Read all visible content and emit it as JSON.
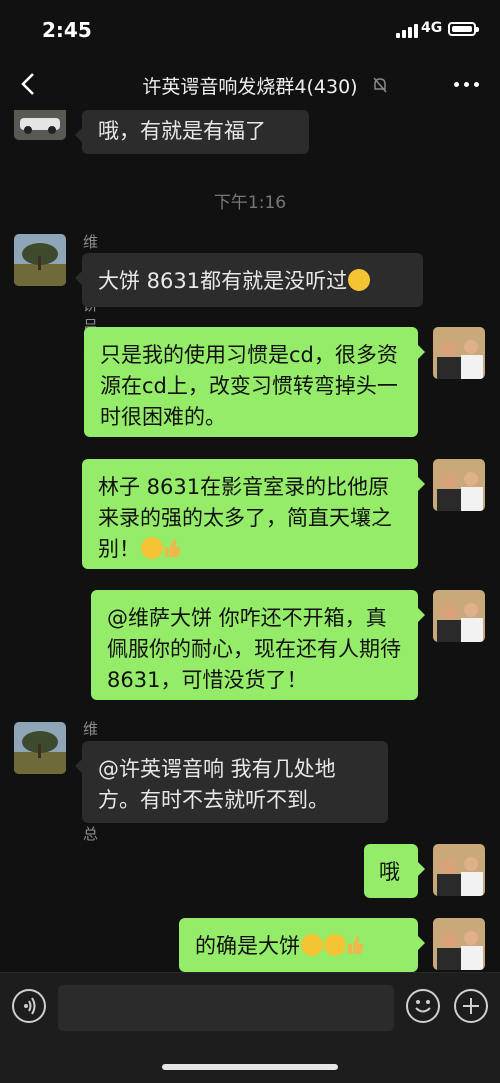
{
  "status_bar": {
    "time": "2:45",
    "network": "4G"
  },
  "header": {
    "title": "许英谔音响发烧群4(430)"
  },
  "icons": {
    "back": "chevron-left-icon",
    "mute": "bell-off-icon",
    "more": "more-dots-icon",
    "voice": "voice-icon",
    "emoji": "smiley-icon",
    "plus": "plus-icon"
  },
  "messages": [
    {
      "side": "left",
      "text": "哦，有就是有福了"
    },
    {
      "timestamp": "下午1:16"
    },
    {
      "side": "left",
      "sender": "维萨大饼吕总",
      "text": "大饼 8631都有就是没听过"
    },
    {
      "side": "right",
      "text": "只是我的使用习惯是cd，很多资源在cd上，改变习惯转弯掉头一时很困难的。"
    },
    {
      "side": "right",
      "text": "林子 8631在影音室录的比他原来录的强的太多了，简直天壤之别！"
    },
    {
      "side": "right",
      "text": "@维萨大饼 你咋还不开箱，真佩服你的耐心，现在还有人期待 8631，可惜没货了！"
    },
    {
      "side": "left",
      "sender": "维萨大饼吕总",
      "text": "@许英谔音响 我有几处地方。有时不去就听不到。"
    },
    {
      "side": "right",
      "text": "哦"
    },
    {
      "side": "right",
      "text": "的确是大饼"
    }
  ],
  "colors": {
    "bubble_right": "#95ec69",
    "bubble_left": "#2c2c2c",
    "background": "#111111"
  }
}
